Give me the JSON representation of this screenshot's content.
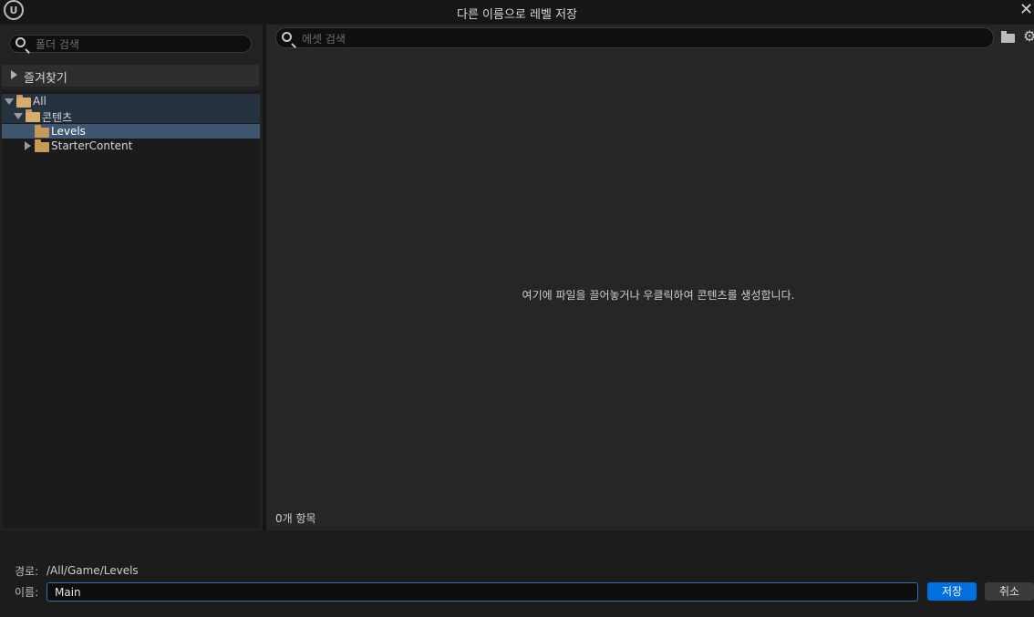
{
  "window": {
    "title": "다른 이름으로 레벨 저장",
    "logo_text": "U",
    "close_glyph": "✕"
  },
  "left": {
    "search_placeholder": "폴더 검색",
    "favorites_label": "즐겨찾기",
    "tree": {
      "all": "All",
      "content": "콘텐츠",
      "levels": "Levels",
      "starter": "StarterContent"
    }
  },
  "right": {
    "search_placeholder": "에셋 검색",
    "empty_message": "여기에 파일을 끌어놓거나 우클릭하여 콘텐츠를 생성합니다.",
    "item_count": "0개 항목",
    "gear_glyph": "⚙"
  },
  "bottom": {
    "path_label": "경로:",
    "path_value": "/All/Game/Levels",
    "name_label": "이름:",
    "name_value": "Main",
    "save_label": "저장",
    "cancel_label": "취소"
  },
  "colors": {
    "accent": "#0070e0",
    "selection": "#3f5671",
    "folder": "#c79a5a"
  },
  "icons": [
    "search-icon",
    "folder-icon",
    "gear-icon",
    "close-icon",
    "chevron-right-icon",
    "chevron-down-icon"
  ]
}
